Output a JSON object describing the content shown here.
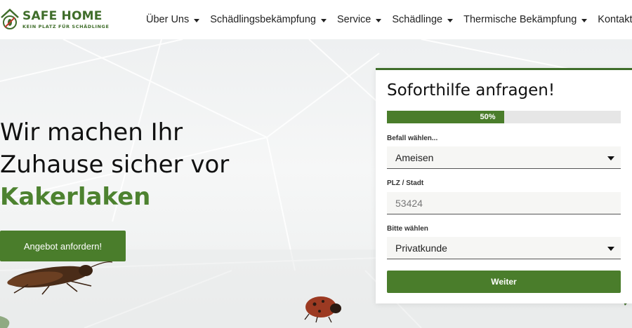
{
  "brand": {
    "name": "SAFE HOME",
    "tagline": "KEIN PLATZ FÜR SCHÄDLINGE",
    "color": "#3f6d2a"
  },
  "nav": {
    "items": [
      {
        "label": "Über Uns",
        "has_dropdown": true
      },
      {
        "label": "Schädlingsbekämpfung",
        "has_dropdown": true
      },
      {
        "label": "Service",
        "has_dropdown": true
      },
      {
        "label": "Schädlinge",
        "has_dropdown": true
      },
      {
        "label": "Thermische Bekämpfung",
        "has_dropdown": true
      },
      {
        "label": "Kontakt",
        "has_dropdown": false
      }
    ]
  },
  "hero": {
    "headline_line1": "Wir machen Ihr",
    "headline_line2": "Zuhause sicher vor",
    "headline_highlight": "Kakerlaken",
    "cta_label": "Angebot anfordern!"
  },
  "form": {
    "title": "Soforthilfe anfragen!",
    "progress_text": "50%",
    "progress_fraction": 0.5,
    "fields": [
      {
        "label": "Befall wählen...",
        "value": "Ameisen",
        "type": "select"
      },
      {
        "label": "PLZ / Stadt",
        "placeholder": "53424",
        "type": "text"
      },
      {
        "label": "Bitte wählen",
        "value": "Privatkunde",
        "type": "select"
      }
    ],
    "submit_label": "Weiter"
  },
  "colors": {
    "accent": "#4a7d2b",
    "headline_highlight": "#4d8230",
    "text": "#111111"
  }
}
